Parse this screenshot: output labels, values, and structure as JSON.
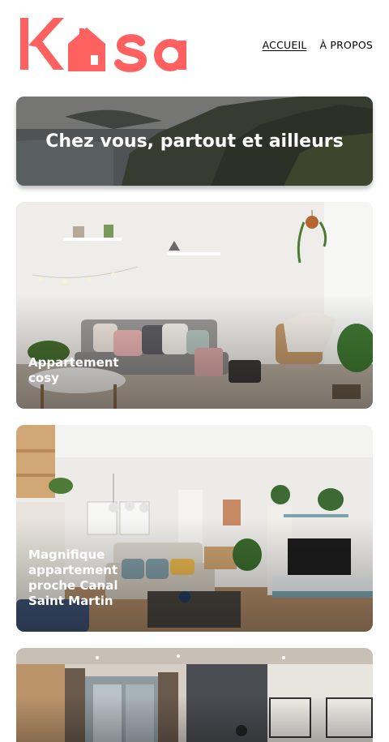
{
  "brand": {
    "logo_text": "Kasa",
    "color": "#FF6060"
  },
  "nav": {
    "items": [
      {
        "label": "ACCUEIL",
        "active": true
      },
      {
        "label": "À PROPOS",
        "active": false
      }
    ]
  },
  "banner": {
    "title": "Chez vous, partout et ailleurs"
  },
  "listings": [
    {
      "title": "Appartement cosy"
    },
    {
      "title": "Magnifique appartement proche Canal Saint Martin"
    },
    {
      "title": ""
    }
  ]
}
